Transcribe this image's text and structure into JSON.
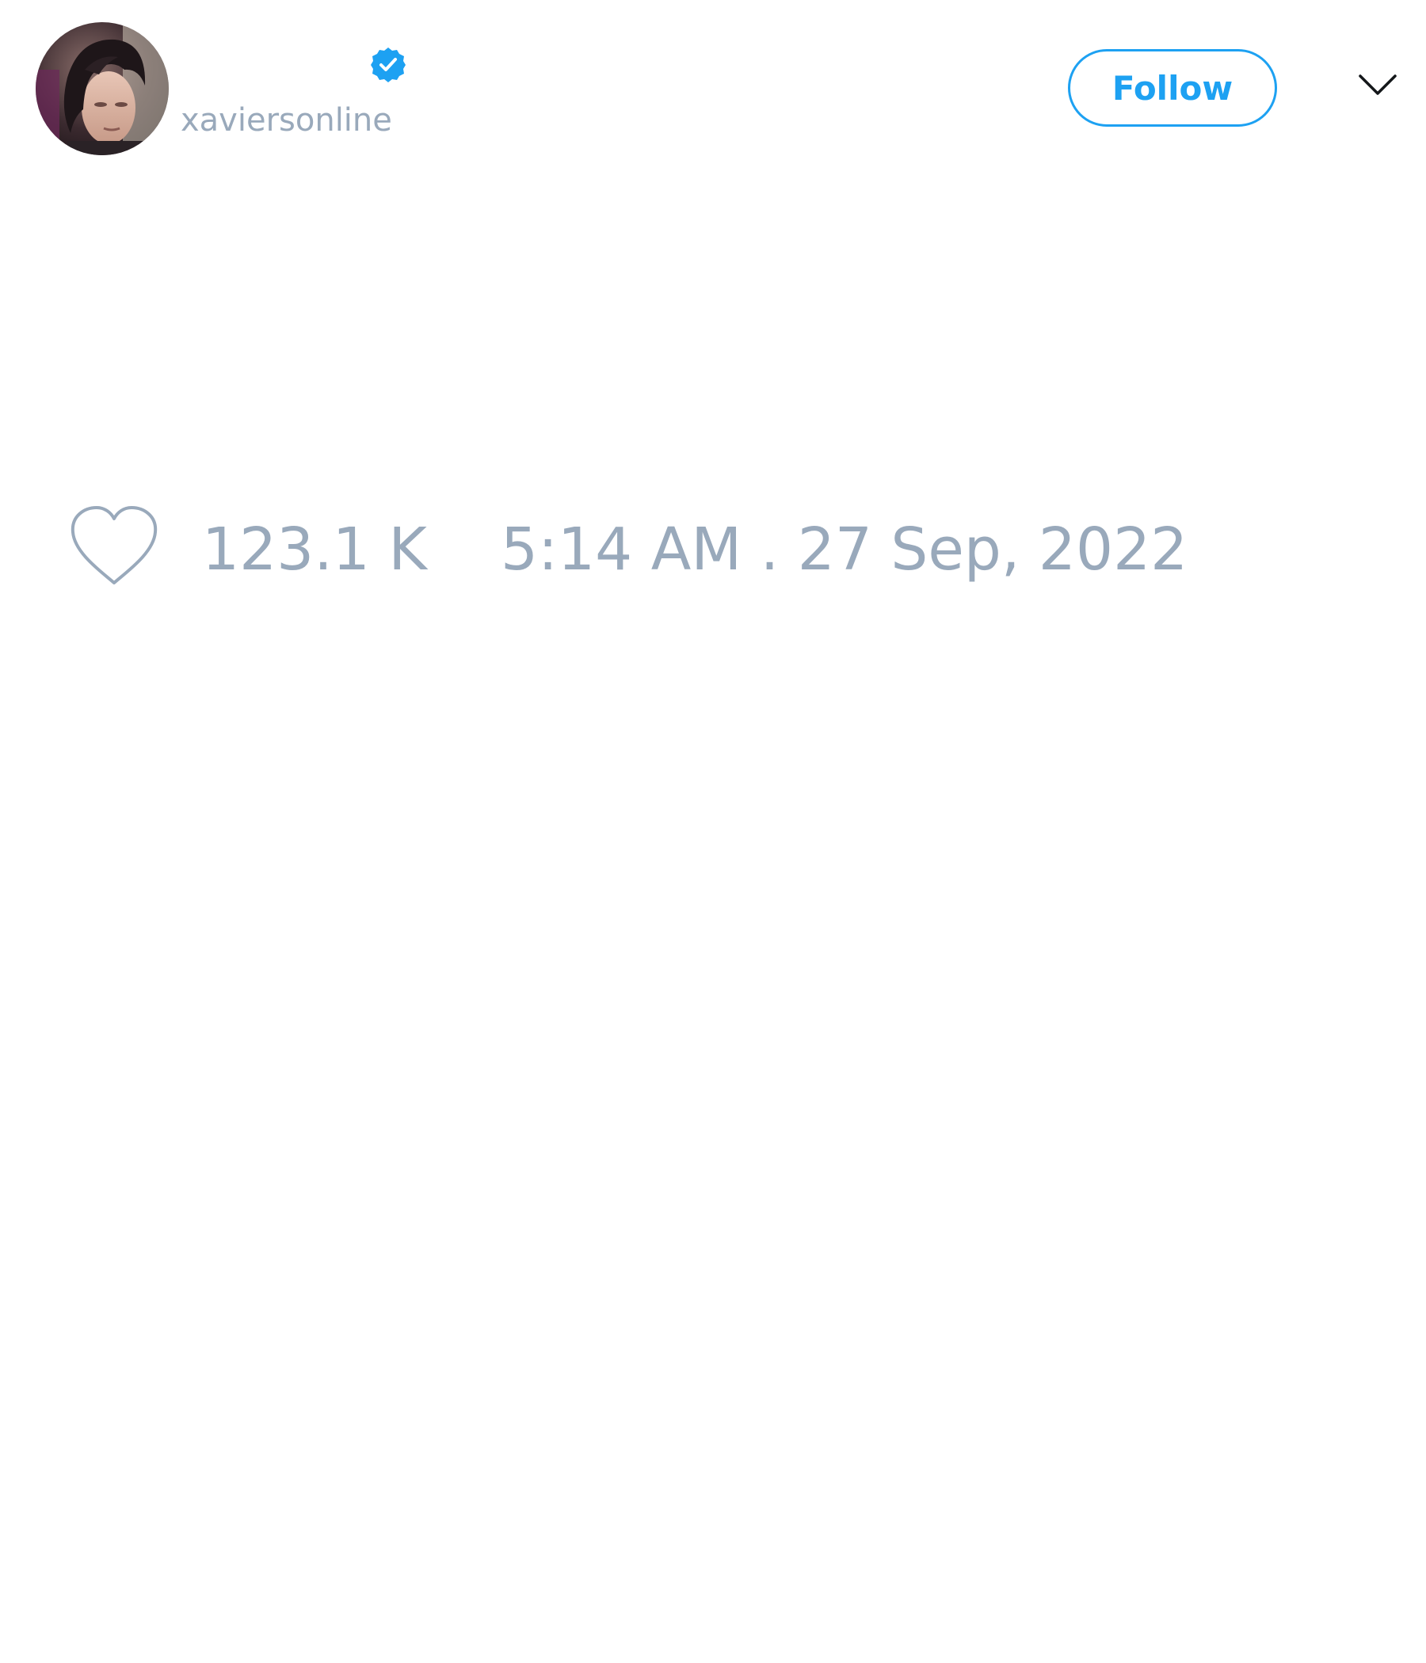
{
  "author": {
    "handle": "xaviersonline",
    "verified": true,
    "avatar_icon": "profile-photo"
  },
  "header": {
    "follow_label": "Follow",
    "menu_icon": "chevron-down-icon"
  },
  "tweet": {
    "like_icon": "heart-outline-icon",
    "like_count": "123.1 K",
    "timestamp": "5:14 AM . 27 Sep, 2022"
  },
  "colors": {
    "accent": "#1da1f2",
    "muted_text": "#99a9bb",
    "background": "#ffffff"
  }
}
